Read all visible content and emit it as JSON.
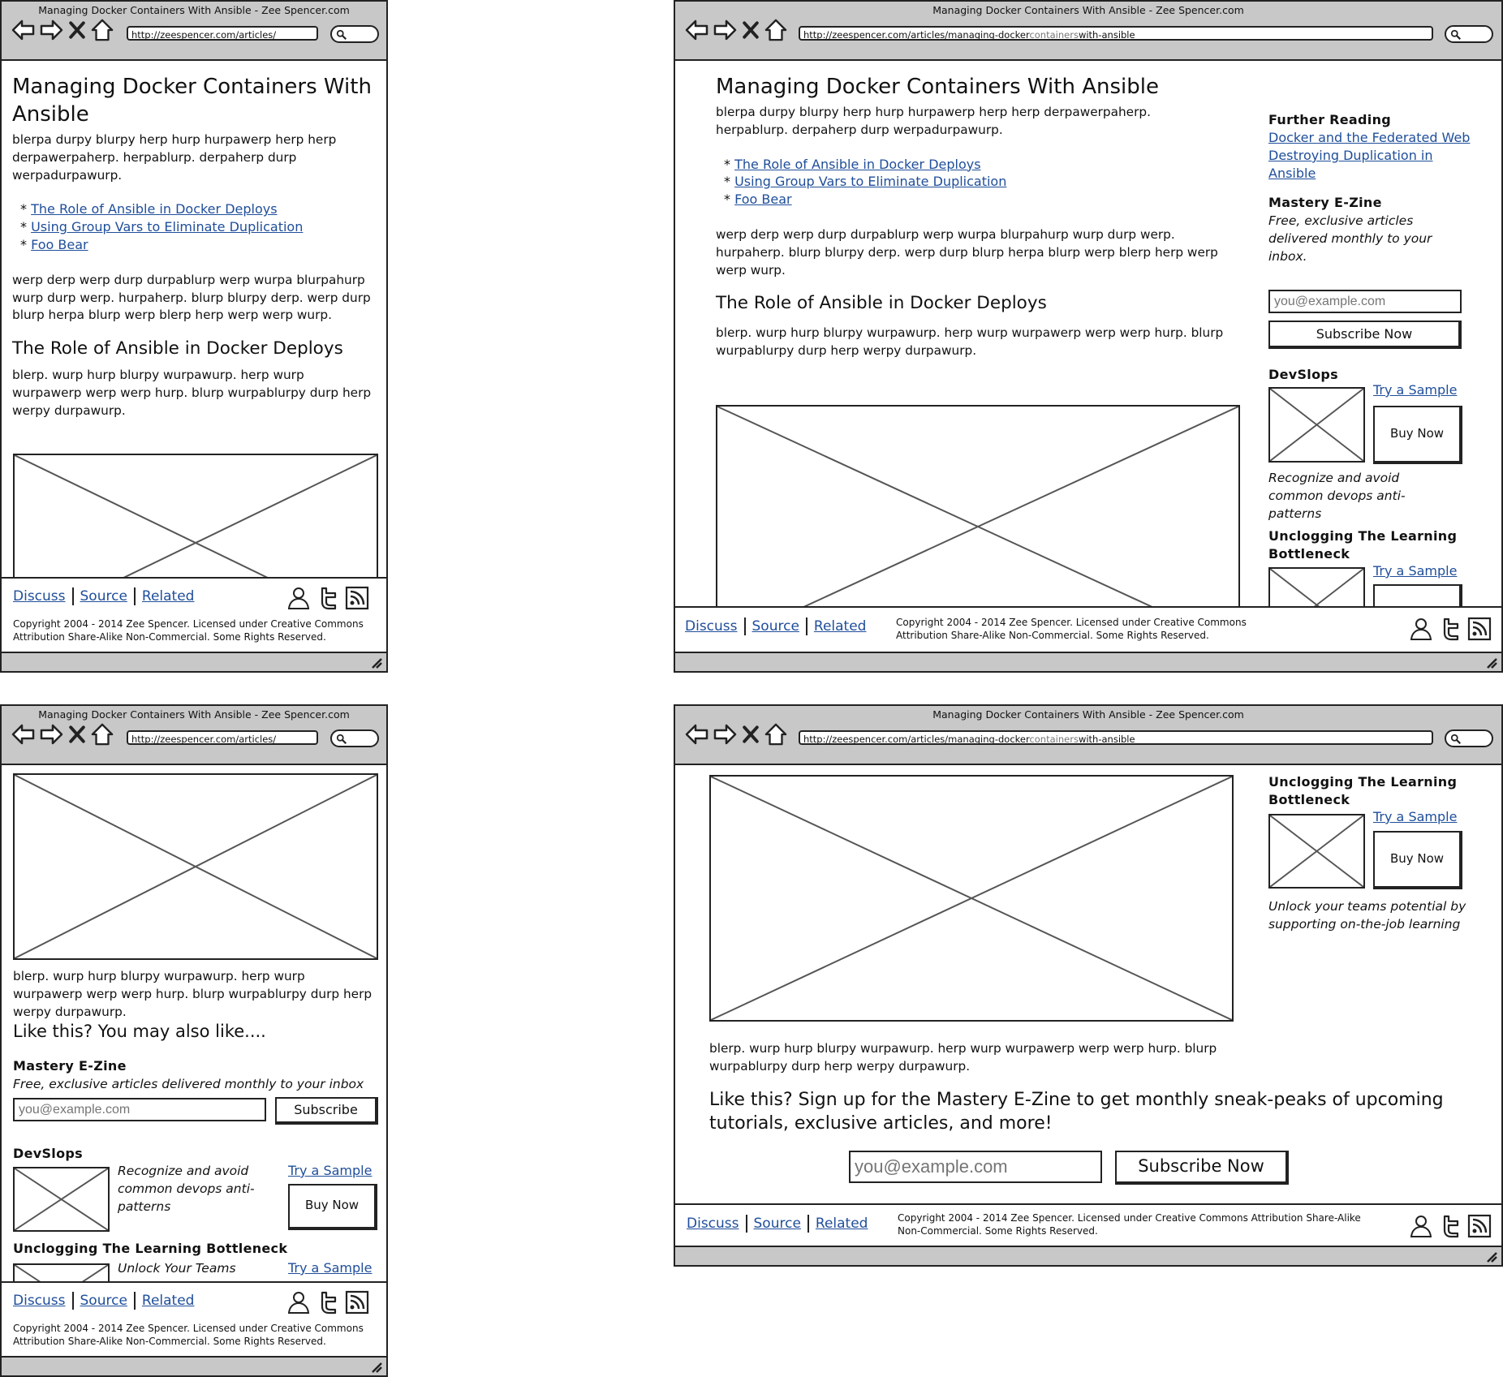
{
  "browser": {
    "title": "Managing Docker Containers With Ansible - Zee Spencer.com",
    "url_short": "http://zeespencer.com/articles/",
    "url_long_a": "http://zeespencer.com/articles/managing-docker",
    "url_long_b": "containers",
    "url_long_c": "with-ansible"
  },
  "article": {
    "title": "Managing Docker Containers With Ansible",
    "intro": "blerpa durpy blurpy herp hurp hurpawerp herp herp derpawerpaherp. herpablurp. derpaherp durp werpadurpawurp.",
    "toc": [
      "The Role of Ansible in Docker Deploys",
      "Using Group Vars to Eliminate Duplication",
      "Foo Bear"
    ],
    "toc_bullet": "*",
    "para2": "werp derp werp durp durpablurp werp wurpa blurpahurp wurp durp werp. hurpaherp. blurp blurpy derp. werp durp blurp herpa blurp werp blerp herp werp werp wurp.",
    "section_title": "The Role of Ansible in Docker Deploys",
    "para3": "blerp. wurp hurp blurpy wurpawurp. herp wurp wurpawerp werp werp hurp. blurp wurpablurpy durp herp werpy durpawurp."
  },
  "sidebar": {
    "further_reading": "Further Reading",
    "reading_links": [
      "Docker and the Federated Web",
      "Destroying Duplication in Ansible"
    ],
    "ezine_title": "Mastery E-Zine",
    "ezine_desc": "Free, exclusive articles delivered monthly to your inbox.",
    "ezine_desc_mobile": "Free, exclusive articles delivered monthly to your inbox",
    "email_placeholder": "you@example.com",
    "subscribe_now": "Subscribe Now",
    "subscribe": "Subscribe",
    "devslops_title": "DevSlops",
    "try_sample": "Try a Sample",
    "buy_now": "Buy Now",
    "devslops_desc": "Recognize and avoid common devops anti-patterns",
    "unclogging_title": "Unclogging The Learning Bottleneck",
    "unclogging_desc": "Unlock your teams potential by supporting on-the-job learning",
    "unclogging_desc_mobile": "Unlock Your Teams"
  },
  "mobile_bottom": {
    "like_this": "Like this? You may also like...."
  },
  "desktop_bottom": {
    "cta": "Like this? Sign up for the Mastery E-Zine to get monthly sneak-peaks of upcoming tutorials, exclusive articles, and more!"
  },
  "footer": {
    "discuss": "Discuss",
    "source": "Source",
    "related": "Related",
    "copyright": "Copyright 2004 - 2014 Zee Spencer. Licensed under Creative Commons Attribution Share-Alike Non-Commercial. Some Rights Reserved."
  },
  "colors": {
    "link": "#1f4e9a",
    "chrome": "#c8c8c8"
  }
}
